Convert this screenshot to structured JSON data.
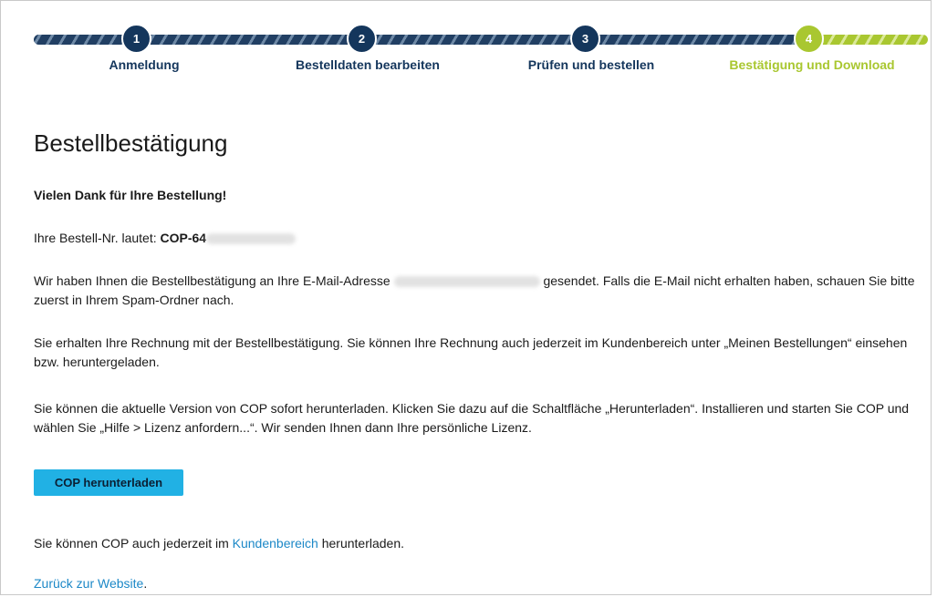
{
  "steps": [
    {
      "number": "1",
      "label": "Anmeldung",
      "state": "done"
    },
    {
      "number": "2",
      "label": "Bestelldaten bearbeiten",
      "state": "done"
    },
    {
      "number": "3",
      "label": "Prüfen und bestellen",
      "state": "done"
    },
    {
      "number": "4",
      "label": "Bestätigung und Download",
      "state": "current"
    }
  ],
  "colors": {
    "done": "#14365c",
    "current": "#a9c730",
    "button": "#21b1e4",
    "link": "#1c88c7"
  },
  "page_title": "Bestellbestätigung",
  "thanks": "Vielen Dank für Ihre Bestellung!",
  "order": {
    "prefix": "Ihre Bestell-Nr. lautet: ",
    "number_visible": "COP-64"
  },
  "email_para": {
    "before": "Wir haben Ihnen die Bestellbestätigung an Ihre E-Mail-Adresse ",
    "after": " gesendet. Falls die E-Mail nicht erhalten haben, schauen Sie bitte zuerst in Ihrem Spam-Ordner nach."
  },
  "invoice_para": "Sie erhalten Ihre Rechnung mit der Bestellbestätigung. Sie können Ihre Rechnung auch jederzeit im Kundenbereich unter „Meinen Bestellungen“ einsehen bzw. heruntergeladen.",
  "download_para": "Sie können die aktuelle Version von COP sofort herunterladen. Klicken Sie dazu auf die Schaltfläche „Herunterladen“. Installieren und starten Sie COP und wählen Sie „Hilfe > Lizenz anfordern...“. Wir senden Ihnen dann Ihre persönliche Lizenz.",
  "download_button": "COP herunterladen",
  "customer_area": {
    "before": "Sie können COP auch jederzeit im ",
    "link": "Kundenbereich",
    "after": " herunterladen."
  },
  "back": {
    "link": "Zurück zur Website",
    "after": "."
  }
}
